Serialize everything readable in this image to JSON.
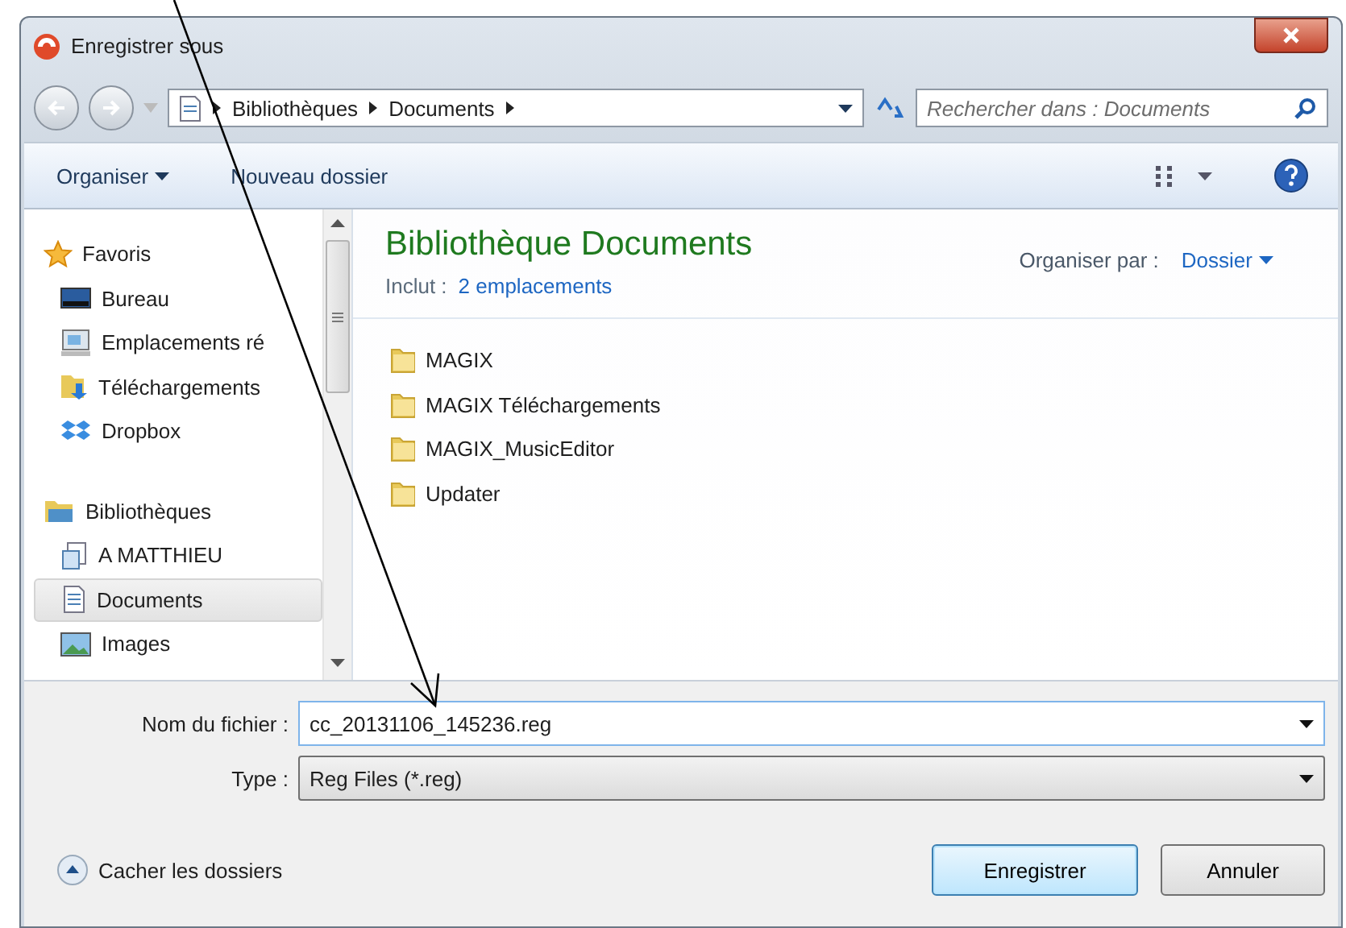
{
  "window": {
    "title": "Enregistrer sous"
  },
  "address": {
    "segments": [
      "Bibliothèques",
      "Documents"
    ]
  },
  "search": {
    "placeholder": "Rechercher dans : Documents"
  },
  "toolbar": {
    "organize": "Organiser",
    "new_folder": "Nouveau dossier"
  },
  "sidebar": {
    "groups": [
      {
        "label": "Favoris",
        "kind": "favorites",
        "children": [
          {
            "label": "Bureau",
            "kind": "desktop",
            "selected": false
          },
          {
            "label": "Emplacements ré",
            "kind": "recent",
            "selected": false
          },
          {
            "label": "Téléchargements",
            "kind": "downloads",
            "selected": false
          },
          {
            "label": "Dropbox",
            "kind": "dropbox",
            "selected": false
          }
        ]
      },
      {
        "label": "Bibliothèques",
        "kind": "libraries",
        "children": [
          {
            "label": "A MATTHIEU",
            "kind": "library",
            "selected": false
          },
          {
            "label": "Documents",
            "kind": "documents",
            "selected": true
          },
          {
            "label": "Images",
            "kind": "images",
            "selected": false
          }
        ]
      }
    ]
  },
  "library": {
    "title": "Bibliothèque Documents",
    "includes_label": "Inclut :",
    "includes_link": "2 emplacements",
    "arrange_label": "Organiser par :",
    "arrange_value": "Dossier"
  },
  "files": [
    {
      "name": "MAGIX"
    },
    {
      "name": "MAGIX Téléchargements"
    },
    {
      "name": "MAGIX_MusicEditor"
    },
    {
      "name": "Updater"
    }
  ],
  "filename": {
    "label": "Nom du fichier :",
    "value": "cc_20131106_145236.reg"
  },
  "filetype": {
    "label": "Type :",
    "value": "Reg Files (*.reg)"
  },
  "hide_folders": "Cacher les dossiers",
  "buttons": [
    {
      "label": "Enregistrer",
      "kind": "primary"
    },
    {
      "label": "Annuler",
      "kind": "default"
    }
  ]
}
